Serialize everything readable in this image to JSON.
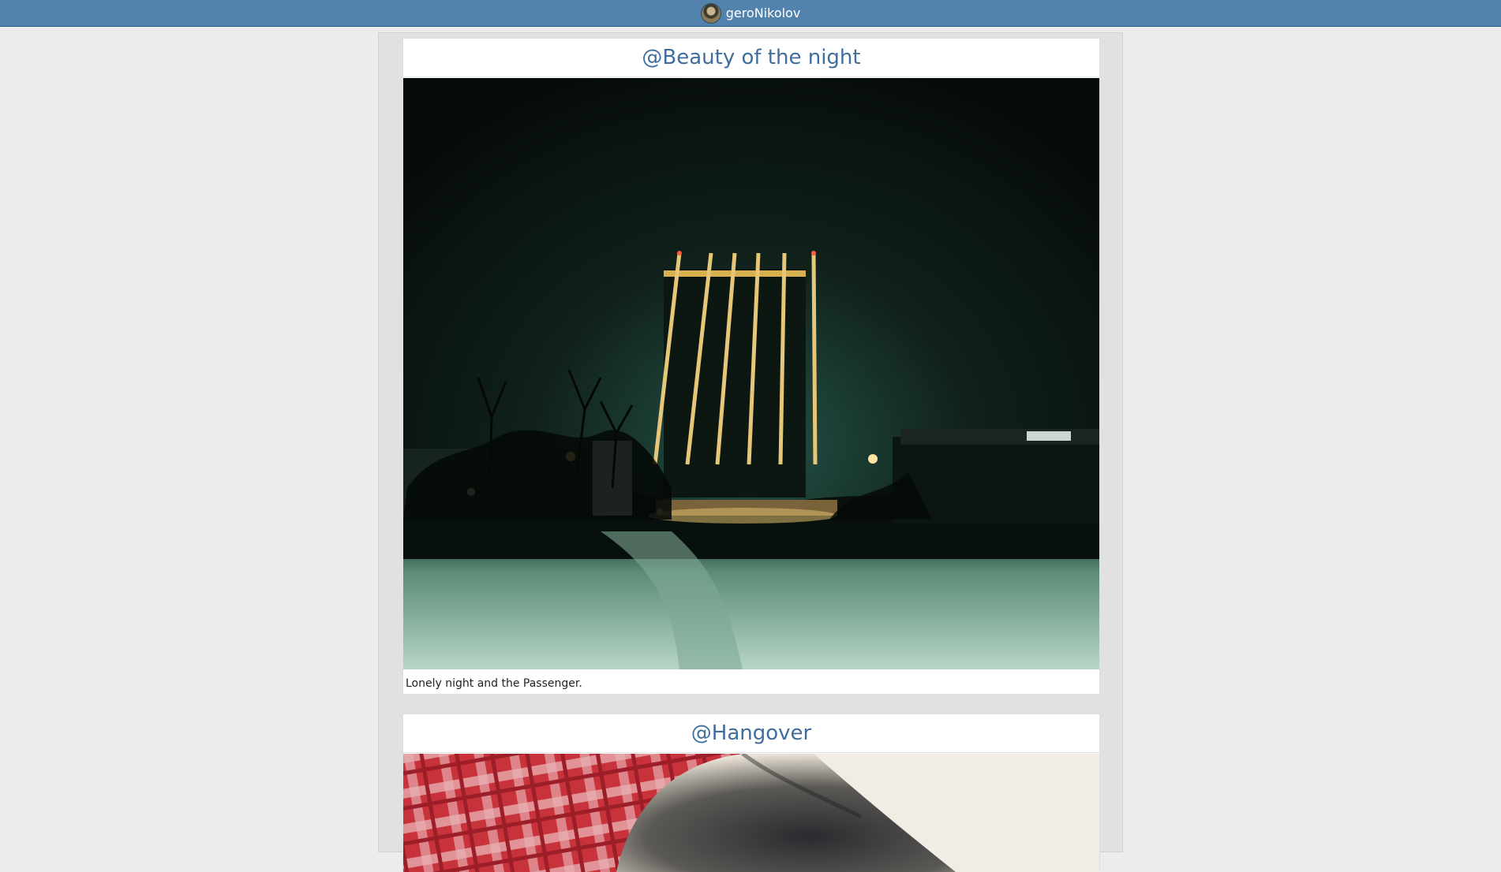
{
  "header": {
    "username": "geroNikolov",
    "avatar_icon": "user-avatar-icon",
    "bar_color": "#5283ad"
  },
  "feed": {
    "posts": [
      {
        "title": "@Beauty of the night",
        "caption": "Lonely night and the Passenger."
      },
      {
        "title": "@Hangover",
        "caption": ""
      }
    ]
  },
  "colors": {
    "page_background": "#ececed",
    "title_color": "#3f6e9c"
  }
}
